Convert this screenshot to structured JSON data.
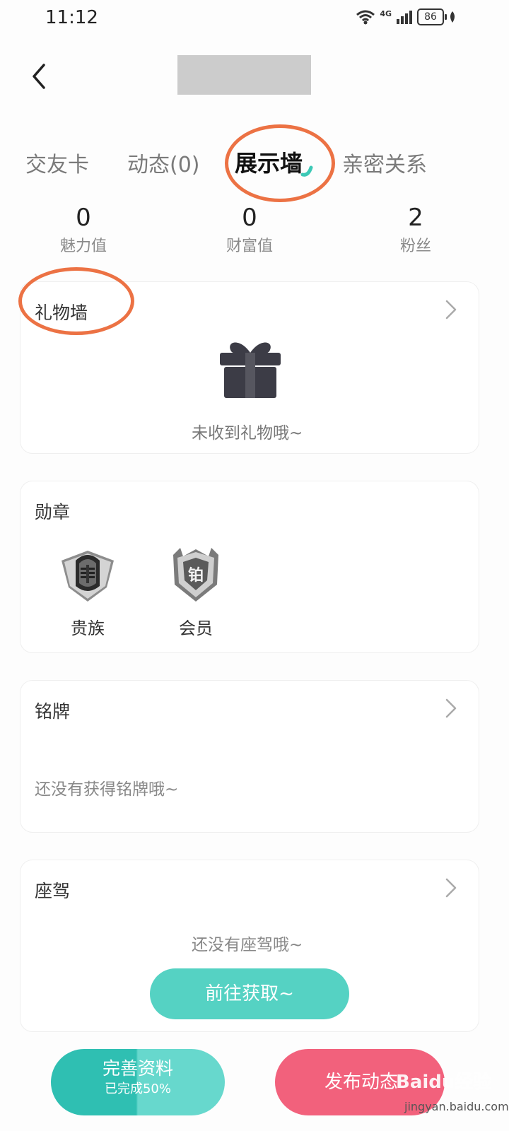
{
  "status_bar": {
    "time": "11:12",
    "network": "4G",
    "battery": "86"
  },
  "header": {
    "back_icon": "chevron-left-icon"
  },
  "tabs": [
    {
      "label": "交友卡",
      "active": false
    },
    {
      "label": "动态(0)",
      "active": false
    },
    {
      "label": "展示墙",
      "active": true
    },
    {
      "label": "亲密关系",
      "active": false
    }
  ],
  "stats": [
    {
      "value": "0",
      "label": "魅力值"
    },
    {
      "value": "0",
      "label": "财富值"
    },
    {
      "value": "2",
      "label": "粉丝"
    }
  ],
  "gift_wall": {
    "title": "礼物墙",
    "empty_text": "未收到礼物哦~",
    "icon": "gift-box-icon"
  },
  "medals": {
    "title": "勋章",
    "items": [
      {
        "label": "贵族",
        "icon": "knight-helmet-badge-icon"
      },
      {
        "label": "会员",
        "icon": "platinum-shield-badge-icon",
        "glyph": "铂"
      }
    ]
  },
  "nameplate": {
    "title": "铭牌",
    "empty_text": "还没有获得铭牌哦~"
  },
  "mount": {
    "title": "座驾",
    "empty_text": "还没有座驾哦~",
    "button": "前往获取~"
  },
  "bottom_bar": {
    "complete_label": "完善资料",
    "complete_progress": "已完成50%",
    "publish_label": "发布动态"
  },
  "watermark": {
    "brand": "Baidu经验",
    "url": "jingyan.baidu.com"
  },
  "colors": {
    "accent_teal": "#55d2c3",
    "accent_pink": "#f2617c",
    "annotation_orange": "#ec7244",
    "placeholder_gray": "#cccccc"
  }
}
